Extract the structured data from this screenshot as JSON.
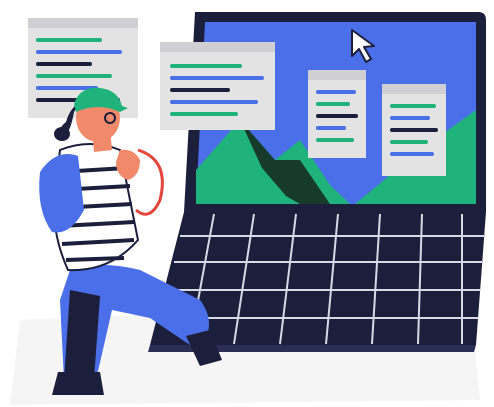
{
  "illustration": {
    "colors": {
      "navy": "#1c1f3b",
      "screen_blue": "#4a6fe8",
      "green": "#1fb27a",
      "dark_green": "#163b2a",
      "panel_gray": "#e3e3e3",
      "coral": "#f08a6a",
      "cap_green": "#1fb27a",
      "red_line": "#e3463b",
      "light_bg": "#f4f4f4"
    },
    "icons": [
      "cursor-arrow-icon"
    ]
  }
}
